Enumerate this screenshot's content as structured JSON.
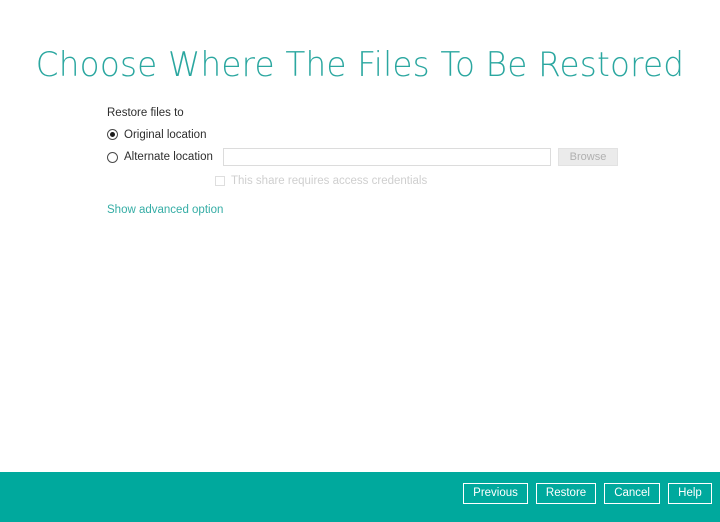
{
  "window": {
    "title": "Choose Where The Files To Be Restored",
    "background": "#ffffff"
  },
  "theme": {
    "accent_teal": "#00a99d",
    "title_teal": "#2ba7a0",
    "link_teal": "#35ada5",
    "text_dark": "#2e2e2e",
    "disabled_gray": "#cfcfcf",
    "input_border": "#dcdcdc"
  },
  "form": {
    "group_label": "Restore files to",
    "options": [
      {
        "label": "Original location",
        "selected": true
      },
      {
        "label": "Alternate location",
        "selected": false
      }
    ],
    "path_input": {
      "value": "",
      "placeholder": ""
    },
    "browse_button": {
      "label": "Browse",
      "enabled": false
    },
    "credentials_checkbox": {
      "label": "This share requires access credentials",
      "checked": false,
      "enabled": false
    },
    "advanced_link": "Show advanced option"
  },
  "footer": {
    "buttons": [
      {
        "label": "Previous"
      },
      {
        "label": "Restore"
      },
      {
        "label": "Cancel"
      },
      {
        "label": "Help"
      }
    ]
  }
}
